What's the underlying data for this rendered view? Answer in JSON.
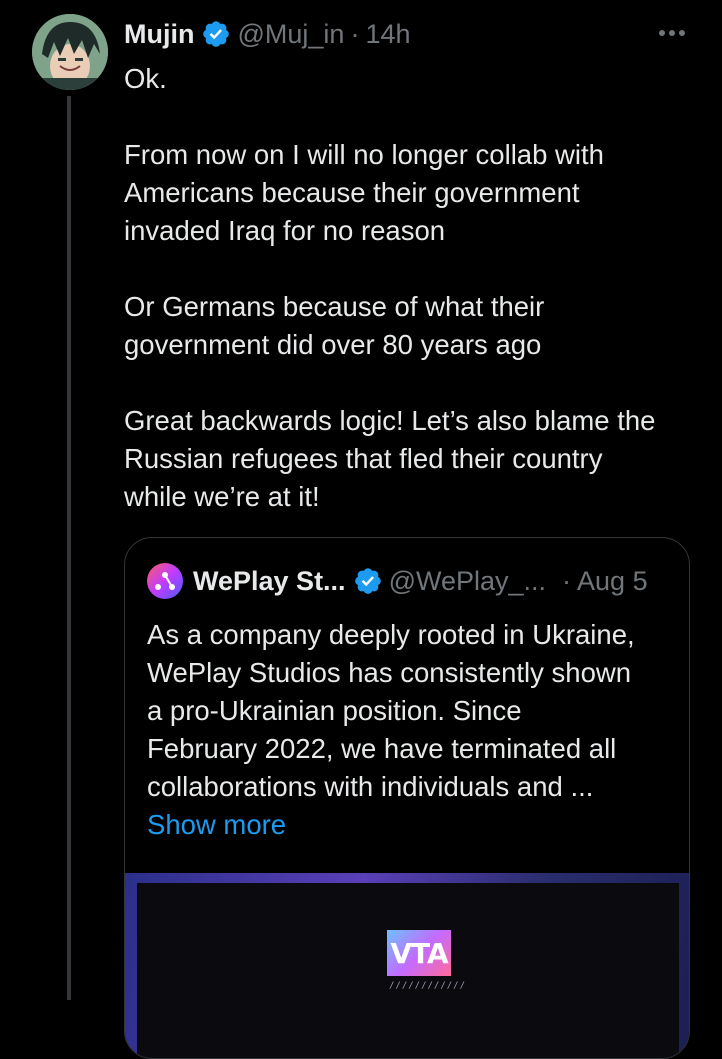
{
  "tweet": {
    "author_name": "Mujin",
    "author_handle": "@Muj_in",
    "separator": "·",
    "time": "14h",
    "paragraphs": [
      "Ok.",
      "From now on I will no longer collab with\nAmericans because their government\ninvaded Iraq for no reason",
      "Or Germans because of what their\ngovernment did over 80 years ago",
      "Great backwards logic! Let’s also blame the\nRussian refugees that fled their country\nwhile we’re at it!"
    ]
  },
  "quoted_tweet": {
    "author_name": "WePlay St...",
    "author_handle": "@WePlay_...",
    "separator": "·",
    "date": "Aug 5",
    "text": "As a company deeply rooted in Ukraine,\nWePlay Studios has consistently shown\na pro-Ukrainian position. Since\nFebruary 2022, we have terminated all\ncollaborations with individuals and ...",
    "show_more_label": "Show more",
    "media_logo_text": "VTA",
    "media_logo_caption": "////////////"
  },
  "colors": {
    "verified_badge": "#1d9bf0",
    "link": "#1d9bf0",
    "muted_text": "#71767b"
  }
}
